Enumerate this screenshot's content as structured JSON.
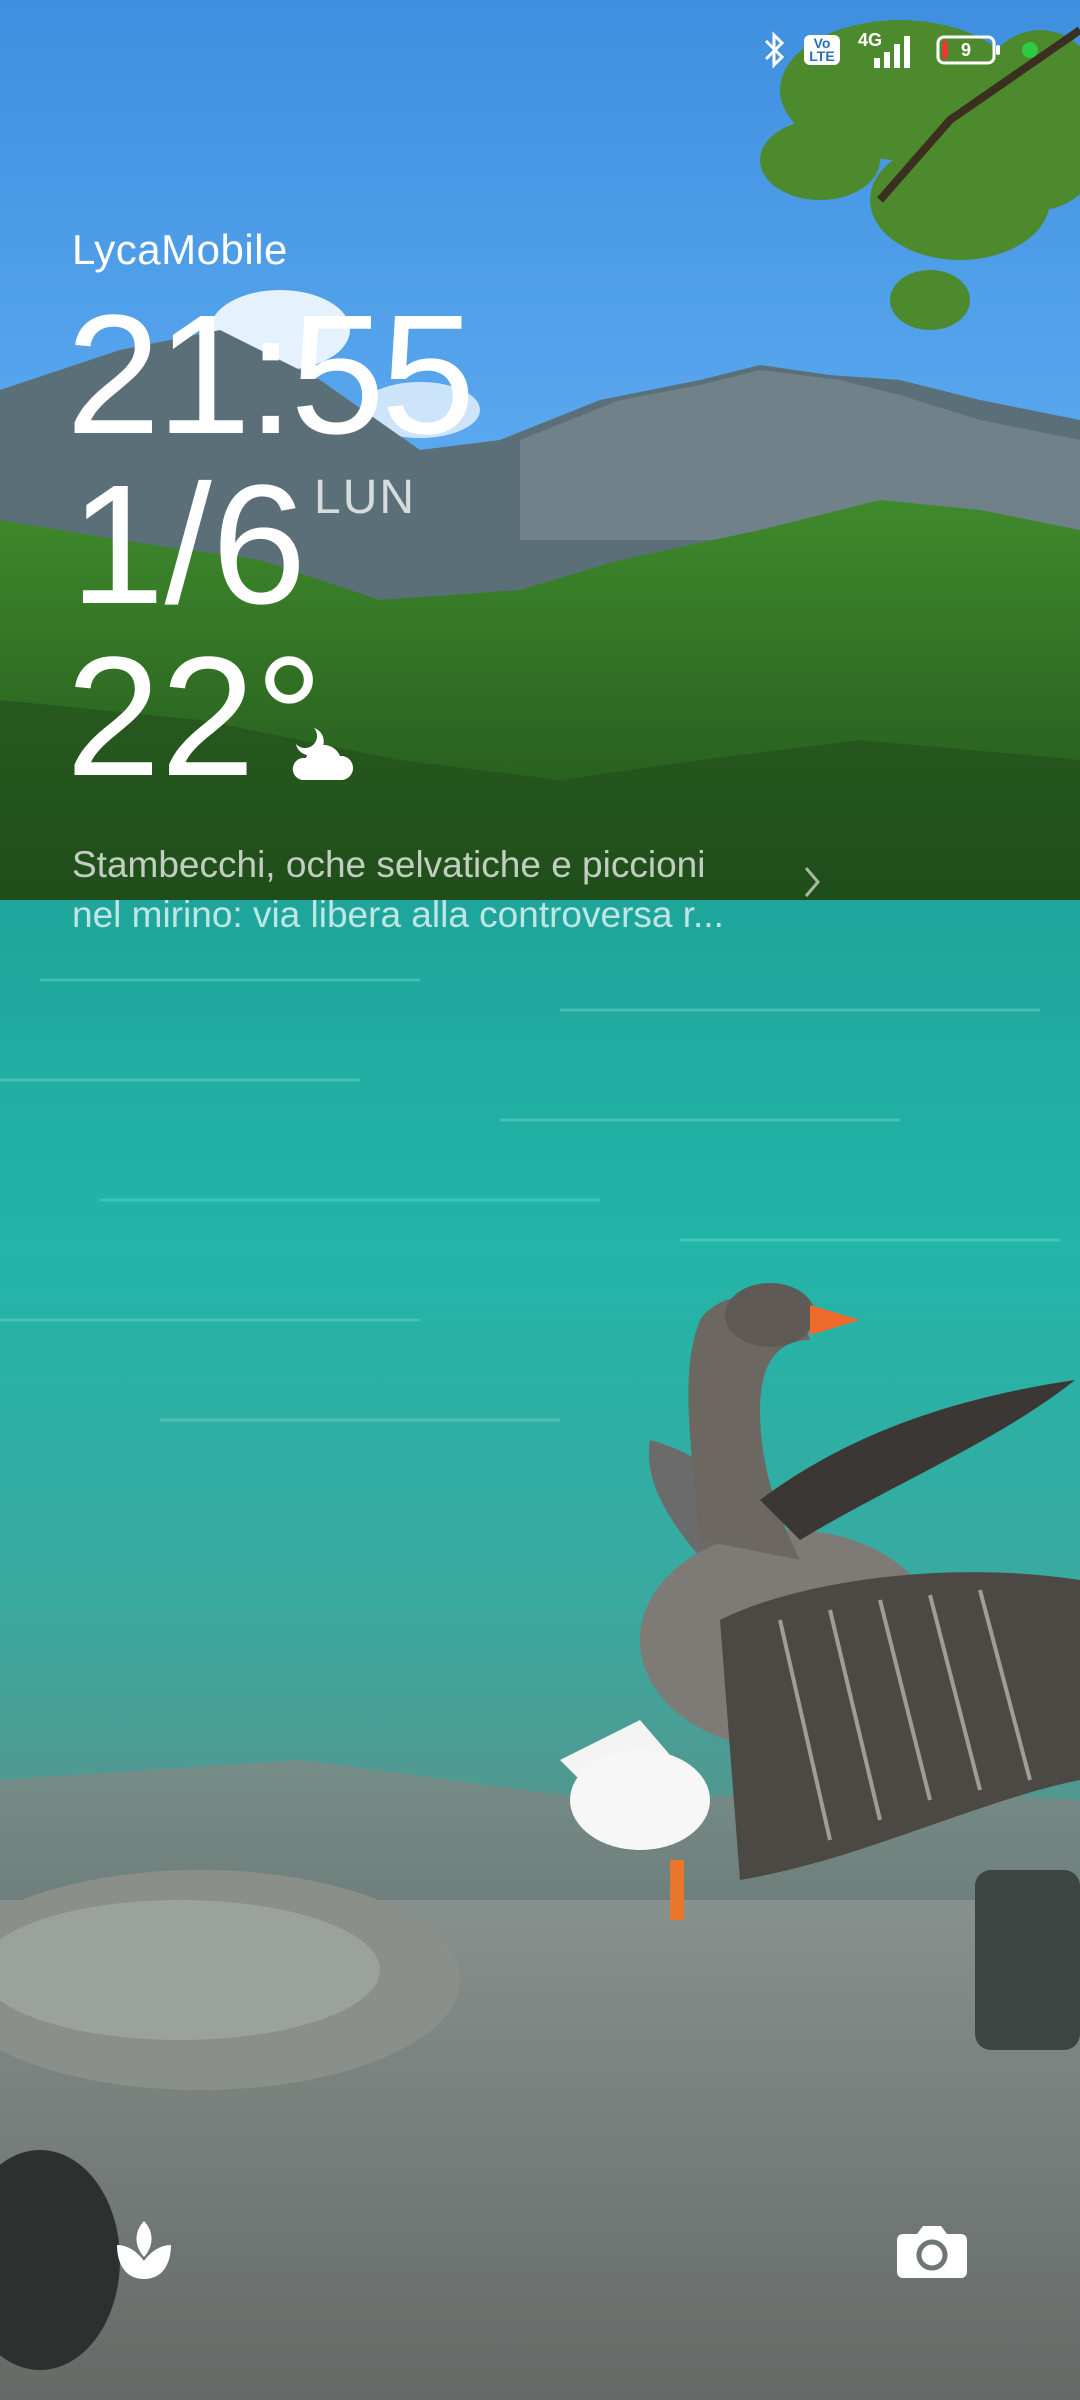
{
  "status_bar": {
    "icons": [
      "bluetooth-icon",
      "volte-icon",
      "4g-signal-icon",
      "battery-icon",
      "privacy-dot-icon"
    ],
    "volte_label": "Vo LTE",
    "network_label": "4G",
    "battery_level": "9",
    "battery_color": "#e53935",
    "privacy_dot_color": "#2ecc40"
  },
  "lockscreen": {
    "carrier": "LycaMobile",
    "time": "21:55",
    "date": "1/6",
    "weekday": "LUN",
    "temperature": "22°",
    "weather_icon": "partly-cloudy-night-icon",
    "news_line1": "Stambecchi, oche selvatiche e piccioni",
    "news_line2": "nel mirino: via libera alla controversa r..."
  },
  "shortcuts": {
    "left_icon": "themes-tulip-icon",
    "right_icon": "camera-icon"
  }
}
